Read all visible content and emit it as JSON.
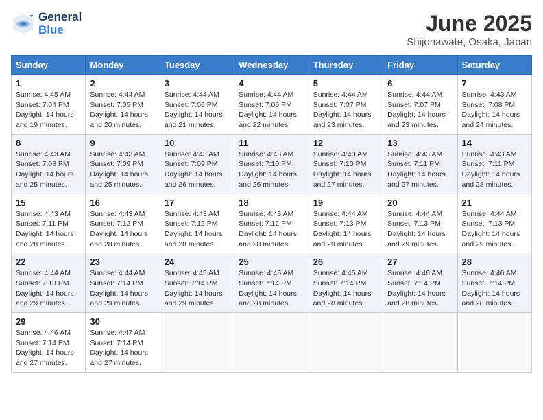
{
  "header": {
    "logo_line1": "General",
    "logo_line2": "Blue",
    "title": "June 2025",
    "subtitle": "Shijonawate, Osaka, Japan"
  },
  "weekdays": [
    "Sunday",
    "Monday",
    "Tuesday",
    "Wednesday",
    "Thursday",
    "Friday",
    "Saturday"
  ],
  "weeks": [
    [
      {
        "day": "1",
        "info": "Sunrise: 4:45 AM\nSunset: 7:04 PM\nDaylight: 14 hours\nand 19 minutes."
      },
      {
        "day": "2",
        "info": "Sunrise: 4:44 AM\nSunset: 7:05 PM\nDaylight: 14 hours\nand 20 minutes."
      },
      {
        "day": "3",
        "info": "Sunrise: 4:44 AM\nSunset: 7:06 PM\nDaylight: 14 hours\nand 21 minutes."
      },
      {
        "day": "4",
        "info": "Sunrise: 4:44 AM\nSunset: 7:06 PM\nDaylight: 14 hours\nand 22 minutes."
      },
      {
        "day": "5",
        "info": "Sunrise: 4:44 AM\nSunset: 7:07 PM\nDaylight: 14 hours\nand 23 minutes."
      },
      {
        "day": "6",
        "info": "Sunrise: 4:44 AM\nSunset: 7:07 PM\nDaylight: 14 hours\nand 23 minutes."
      },
      {
        "day": "7",
        "info": "Sunrise: 4:43 AM\nSunset: 7:08 PM\nDaylight: 14 hours\nand 24 minutes."
      }
    ],
    [
      {
        "day": "8",
        "info": "Sunrise: 4:43 AM\nSunset: 7:08 PM\nDaylight: 14 hours\nand 25 minutes."
      },
      {
        "day": "9",
        "info": "Sunrise: 4:43 AM\nSunset: 7:09 PM\nDaylight: 14 hours\nand 25 minutes."
      },
      {
        "day": "10",
        "info": "Sunrise: 4:43 AM\nSunset: 7:09 PM\nDaylight: 14 hours\nand 26 minutes."
      },
      {
        "day": "11",
        "info": "Sunrise: 4:43 AM\nSunset: 7:10 PM\nDaylight: 14 hours\nand 26 minutes."
      },
      {
        "day": "12",
        "info": "Sunrise: 4:43 AM\nSunset: 7:10 PM\nDaylight: 14 hours\nand 27 minutes."
      },
      {
        "day": "13",
        "info": "Sunrise: 4:43 AM\nSunset: 7:11 PM\nDaylight: 14 hours\nand 27 minutes."
      },
      {
        "day": "14",
        "info": "Sunrise: 4:43 AM\nSunset: 7:11 PM\nDaylight: 14 hours\nand 28 minutes."
      }
    ],
    [
      {
        "day": "15",
        "info": "Sunrise: 4:43 AM\nSunset: 7:11 PM\nDaylight: 14 hours\nand 28 minutes."
      },
      {
        "day": "16",
        "info": "Sunrise: 4:43 AM\nSunset: 7:12 PM\nDaylight: 14 hours\nand 28 minutes."
      },
      {
        "day": "17",
        "info": "Sunrise: 4:43 AM\nSunset: 7:12 PM\nDaylight: 14 hours\nand 28 minutes."
      },
      {
        "day": "18",
        "info": "Sunrise: 4:43 AM\nSunset: 7:12 PM\nDaylight: 14 hours\nand 28 minutes."
      },
      {
        "day": "19",
        "info": "Sunrise: 4:44 AM\nSunset: 7:13 PM\nDaylight: 14 hours\nand 29 minutes."
      },
      {
        "day": "20",
        "info": "Sunrise: 4:44 AM\nSunset: 7:13 PM\nDaylight: 14 hours\nand 29 minutes."
      },
      {
        "day": "21",
        "info": "Sunrise: 4:44 AM\nSunset: 7:13 PM\nDaylight: 14 hours\nand 29 minutes."
      }
    ],
    [
      {
        "day": "22",
        "info": "Sunrise: 4:44 AM\nSunset: 7:13 PM\nDaylight: 14 hours\nand 29 minutes."
      },
      {
        "day": "23",
        "info": "Sunrise: 4:44 AM\nSunset: 7:14 PM\nDaylight: 14 hours\nand 29 minutes."
      },
      {
        "day": "24",
        "info": "Sunrise: 4:45 AM\nSunset: 7:14 PM\nDaylight: 14 hours\nand 29 minutes."
      },
      {
        "day": "25",
        "info": "Sunrise: 4:45 AM\nSunset: 7:14 PM\nDaylight: 14 hours\nand 28 minutes."
      },
      {
        "day": "26",
        "info": "Sunrise: 4:45 AM\nSunset: 7:14 PM\nDaylight: 14 hours\nand 28 minutes."
      },
      {
        "day": "27",
        "info": "Sunrise: 4:46 AM\nSunset: 7:14 PM\nDaylight: 14 hours\nand 28 minutes."
      },
      {
        "day": "28",
        "info": "Sunrise: 4:46 AM\nSunset: 7:14 PM\nDaylight: 14 hours\nand 28 minutes."
      }
    ],
    [
      {
        "day": "29",
        "info": "Sunrise: 4:46 AM\nSunset: 7:14 PM\nDaylight: 14 hours\nand 27 minutes."
      },
      {
        "day": "30",
        "info": "Sunrise: 4:47 AM\nSunset: 7:14 PM\nDaylight: 14 hours\nand 27 minutes."
      },
      {
        "day": "",
        "info": ""
      },
      {
        "day": "",
        "info": ""
      },
      {
        "day": "",
        "info": ""
      },
      {
        "day": "",
        "info": ""
      },
      {
        "day": "",
        "info": ""
      }
    ]
  ]
}
